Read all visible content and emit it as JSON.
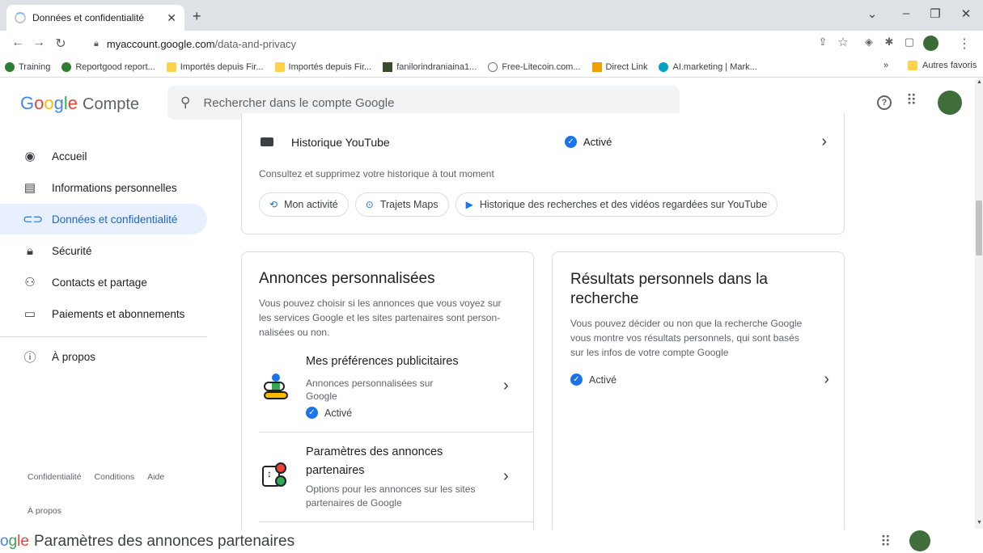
{
  "browser": {
    "tab_title": "Données et confidentialité",
    "url_domain": "myaccount.google.com",
    "url_path": "/data-and-privacy",
    "bookmarks": [
      "Training",
      "Reportgood report...",
      "Importés depuis Fir...",
      "Importés depuis Fir...",
      "fanilorindraniaina1...",
      "Free-Litecoin.com...",
      "Direct Link",
      "AI.marketing | Mark..."
    ],
    "other_bookmarks": "Autres favoris",
    "more": "»"
  },
  "header": {
    "logo": "Google",
    "product": "Compte",
    "search_placeholder": "Rechercher dans le compte Google"
  },
  "sidebar": {
    "items": [
      {
        "label": "Accueil",
        "icon": "home-icon"
      },
      {
        "label": "Informations personnelles",
        "icon": "id-card-icon"
      },
      {
        "label": "Données et confidentialité",
        "icon": "toggle-icon"
      },
      {
        "label": "Sécurité",
        "icon": "lock-icon"
      },
      {
        "label": "Contacts et partage",
        "icon": "people-icon"
      },
      {
        "label": "Paiements et abonnements",
        "icon": "card-icon"
      }
    ],
    "about": "À propos",
    "footer_links": [
      "Confidentialité",
      "Conditions",
      "Aide"
    ],
    "footer_about": "À propos"
  },
  "history_card": {
    "title": "Historique YouTube",
    "status": "Activé",
    "description": "Consultez et supprimez votre historique à tout moment",
    "chips": [
      "Mon activité",
      "Trajets Maps",
      "Historique des recherches et des vidéos regardées sur YouTube"
    ]
  },
  "ads_card": {
    "title": "Annonces personnalisées",
    "description_lines": [
      "Vous pouvez choisir si les annonces que vous voyez sur",
      "les services Google et les sites partenaires sont person-",
      "nalisées ou non."
    ],
    "item1": {
      "title": "Mes préférences publicitaires",
      "subtitle_lines": [
        "Annonces personnalisées sur",
        "Google"
      ],
      "status": "Activé"
    },
    "item2": {
      "title_lines": [
        "Paramètres des annonces",
        "partenaires"
      ],
      "subtitle_lines": [
        "Options pour les annonces sur les sites",
        "partenaires de Google"
      ]
    }
  },
  "search_card": {
    "title_lines": [
      "Résultats personnels dans la",
      "recherche"
    ],
    "description_lines": [
      "Vous pouvez décider ou non que la recherche Google",
      "vous montre vos résultats personnels, qui sont basés",
      "sur les infos de votre compte Google"
    ],
    "status": "Activé"
  },
  "bottom_bar": {
    "logo_fragment": "ogle",
    "title": "Paramètres des annonces partenaires"
  },
  "colors": {
    "accent": "#1a73e8",
    "active_bg": "#e8f0fe"
  }
}
